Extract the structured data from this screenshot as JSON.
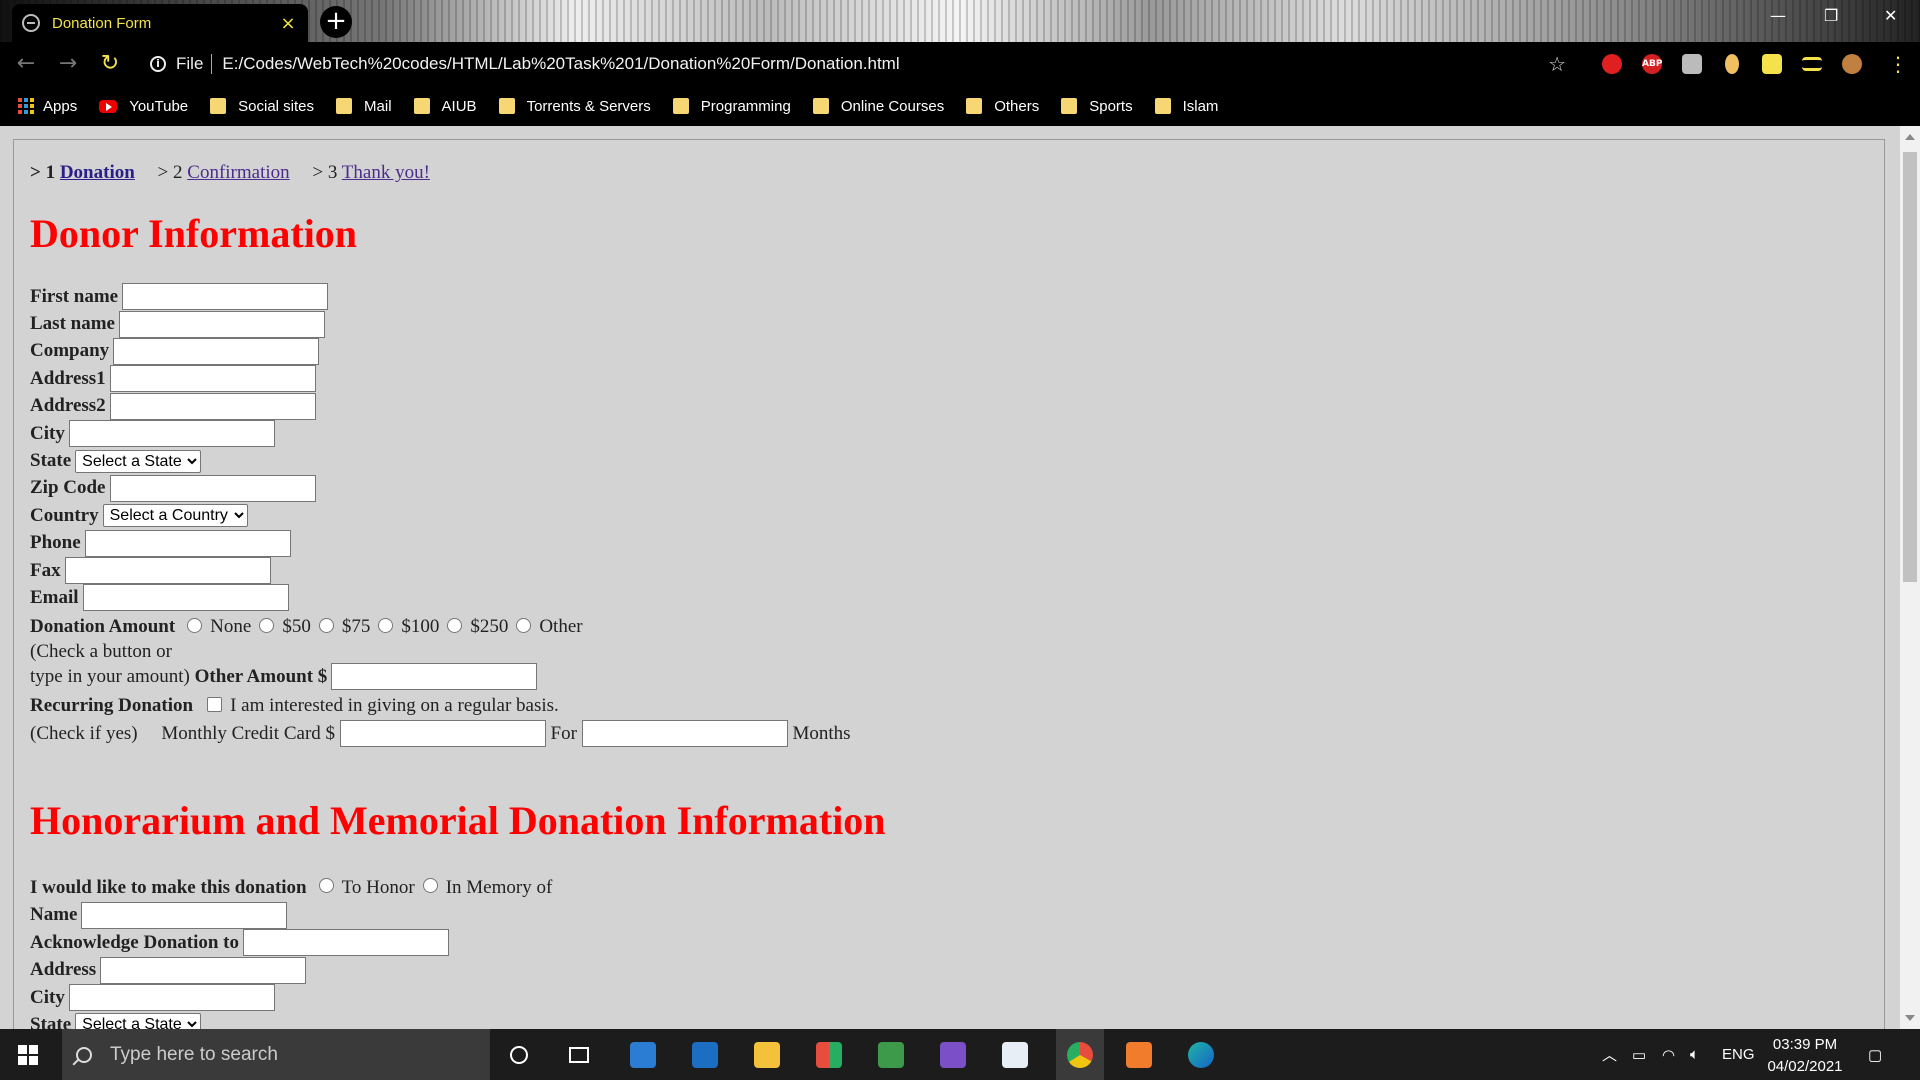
{
  "browser": {
    "tab_title": "Donation Form",
    "tab_close": "×",
    "new_tab": "+",
    "scheme_label": "File",
    "url": "E:/Codes/WebTech%20codes/HTML/Lab%20Task%201/Donation%20Form/Donation.html",
    "window_controls": {
      "minimize": "—",
      "maximize": "❐",
      "close": "✕"
    }
  },
  "extensions": [
    {
      "name": "ext-red-icon",
      "color": "#e02020"
    },
    {
      "name": "adblock-icon",
      "label": "ABP",
      "color": "#d42020"
    },
    {
      "name": "ext-gray-icon",
      "color": "#bbbbbb"
    },
    {
      "name": "ext-cookie-icon",
      "color": "#f0c060"
    },
    {
      "name": "puzzle-icon",
      "color": "#f3e24a"
    },
    {
      "name": "reading-list-icon",
      "color": "#f3e24a"
    },
    {
      "name": "profile-avatar-icon",
      "color": "#c08040"
    },
    {
      "name": "menu-icon",
      "color": "#f3e24a"
    }
  ],
  "bookmarks": [
    {
      "label": "Apps",
      "icon": "apps-grid-icon"
    },
    {
      "label": "YouTube",
      "icon": "youtube-icon"
    },
    {
      "label": "Social sites",
      "icon": "folder-icon"
    },
    {
      "label": "Mail",
      "icon": "folder-icon"
    },
    {
      "label": "AIUB",
      "icon": "folder-icon"
    },
    {
      "label": "Torrents & Servers",
      "icon": "folder-icon"
    },
    {
      "label": "Programming",
      "icon": "folder-icon"
    },
    {
      "label": "Online Courses",
      "icon": "folder-icon"
    },
    {
      "label": "Others",
      "icon": "folder-icon"
    },
    {
      "label": "Sports",
      "icon": "folder-icon"
    },
    {
      "label": "Islam",
      "icon": "folder-icon"
    }
  ],
  "steps": [
    {
      "prefix": "> 1",
      "label": "Donation"
    },
    {
      "prefix": "> 2",
      "label": "Confirmation"
    },
    {
      "prefix": "> 3",
      "label": "Thank you!"
    }
  ],
  "donor": {
    "heading": "Donor Information",
    "first_name": "First name",
    "last_name": "Last name",
    "company": "Company",
    "address1": "Address1",
    "address2": "Address2",
    "city": "City",
    "state": "State",
    "state_select": "Select a State",
    "zip": "Zip Code",
    "country": "Country",
    "country_select": "Select a Country",
    "phone": "Phone",
    "fax": "Fax",
    "email": "Email",
    "donation_amount": "Donation Amount",
    "amount_options": [
      "None",
      "$50",
      "$75",
      "$100",
      "$250",
      "Other"
    ],
    "check_hint_1": "(Check a button or",
    "check_hint_2": "type in your amount)",
    "other_amount": "Other Amount $",
    "recurring": "Recurring Donation",
    "recurring_text": "I am interested in giving on a regular basis.",
    "check_if_yes": "(Check if yes)",
    "monthly_cc": "Monthly Credit Card $",
    "for_label": "For",
    "months_label": "Months"
  },
  "honorarium": {
    "heading": "Honorarium and Memorial Donation Information",
    "make_donation": "I would like to make this donation",
    "to_honor": "To Honor",
    "in_memory": "In Memory of",
    "name": "Name",
    "acknowledge": "Acknowledge Donation to",
    "address": "Address",
    "city": "City",
    "state": "State",
    "state_select": "Select a State"
  },
  "taskbar": {
    "search_placeholder": "Type here to search",
    "language": "ENG",
    "time": "03:39 PM",
    "date": "04/02/2021"
  }
}
